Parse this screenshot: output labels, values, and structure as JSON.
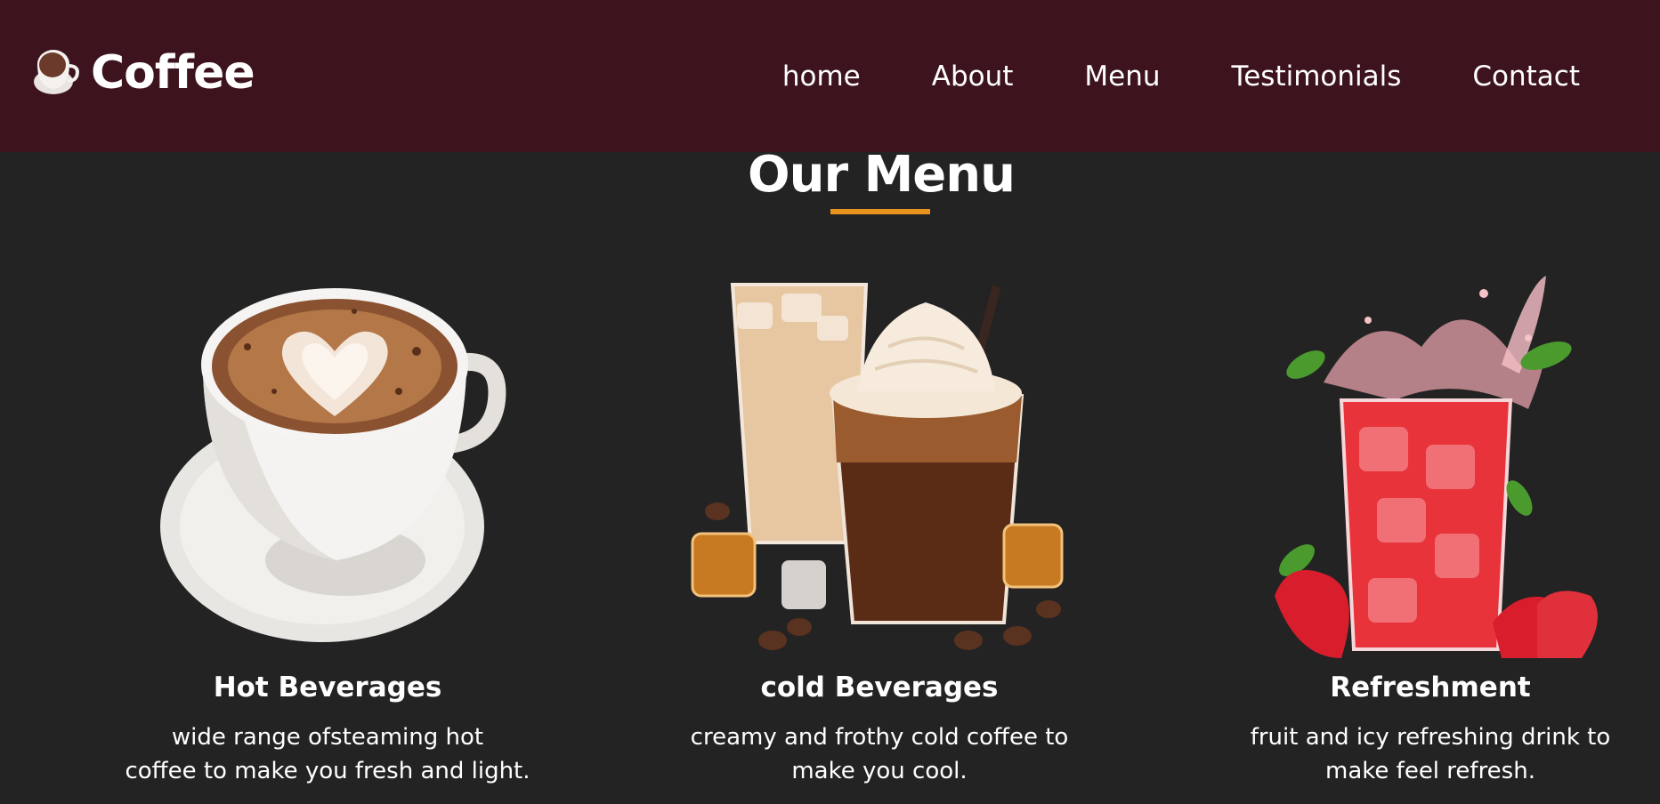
{
  "brand": {
    "name": "Coffee",
    "icon": "coffee-cup-icon"
  },
  "nav": {
    "items": [
      {
        "label": "home"
      },
      {
        "label": "About"
      },
      {
        "label": "Menu"
      },
      {
        "label": "Testimonials"
      },
      {
        "label": "Contact"
      }
    ]
  },
  "menu": {
    "title": "Our Menu",
    "cards": [
      {
        "title": "Hot Beverages",
        "desc_line1": "wide range ofsteaming hot",
        "desc_line2": "coffee to make you fresh and light.",
        "image": "hot-coffee-cup-image"
      },
      {
        "title": "cold Beverages",
        "desc_line1": "creamy and frothy cold coffee to",
        "desc_line2": "make you cool.",
        "image": "iced-coffee-image"
      },
      {
        "title": "Refreshment",
        "desc_line1": "fruit and icy refreshing drink to",
        "desc_line2": "make feel refresh.",
        "image": "strawberry-drink-image"
      }
    ]
  },
  "colors": {
    "navbar_bg": "#3d141d",
    "page_bg": "#232323",
    "accent": "#e8931c",
    "text": "#ffffff"
  }
}
